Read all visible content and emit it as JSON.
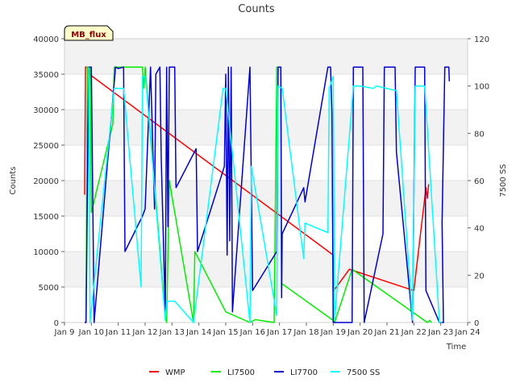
{
  "chart_data": {
    "type": "line",
    "title": "Counts",
    "xlabel": "Time",
    "ylabel": "Counts",
    "y2label": "7500 SS",
    "badge": "MB_flux",
    "ylim": [
      0,
      40000
    ],
    "y2lim": [
      0,
      120
    ],
    "xlim": [
      0,
      15
    ],
    "y_ticks": [
      0,
      5000,
      10000,
      15000,
      20000,
      25000,
      30000,
      35000,
      40000
    ],
    "y2_ticks": [
      0,
      20,
      40,
      60,
      80,
      100,
      120
    ],
    "x_tick_labels": [
      "Jan 9",
      "Jan 10",
      "Jan 11",
      "Jan 12",
      "Jan 13",
      "Jan 14",
      "Jan 15",
      "Jan 16",
      "Jan 17",
      "Jan 18",
      "Jan 19",
      "Jan 20",
      "Jan 21",
      "Jan 22",
      "Jan 23",
      "Jan 24"
    ],
    "grid": true,
    "legend_position": "bottom",
    "series": [
      {
        "name": "WMP",
        "color": "#ff0000",
        "axis": "left",
        "points": [
          [
            0.75,
            18000
          ],
          [
            0.78,
            36000
          ],
          [
            0.9,
            36000
          ],
          [
            0.92,
            35000
          ],
          [
            10.0,
            9500
          ],
          [
            10.02,
            4500
          ],
          [
            10.6,
            7500
          ],
          [
            13.0,
            4500
          ],
          [
            13.45,
            19000
          ],
          [
            13.5,
            17500
          ],
          [
            13.55,
            19500
          ]
        ]
      },
      {
        "name": "LI7500",
        "color": "#00ee00",
        "axis": "left",
        "points": [
          [
            0.8,
            0
          ],
          [
            0.85,
            36000
          ],
          [
            0.95,
            36000
          ],
          [
            1.0,
            15500
          ],
          [
            1.8,
            28000
          ],
          [
            1.85,
            36000
          ],
          [
            2.0,
            36000
          ],
          [
            2.9,
            36000
          ],
          [
            2.95,
            33000
          ],
          [
            3.0,
            36000
          ],
          [
            3.75,
            1000
          ],
          [
            3.8,
            0
          ],
          [
            3.9,
            20000
          ],
          [
            4.8,
            0
          ],
          [
            4.85,
            10000
          ],
          [
            6.0,
            1500
          ],
          [
            6.9,
            0
          ],
          [
            7.1,
            400
          ],
          [
            7.8,
            0
          ],
          [
            7.9,
            36000
          ],
          [
            8.05,
            36000
          ],
          [
            8.08,
            5500
          ],
          [
            10.0,
            300
          ],
          [
            10.05,
            0
          ],
          [
            10.7,
            7500
          ],
          [
            13.5,
            0
          ],
          [
            13.6,
            300
          ],
          [
            13.65,
            0
          ]
        ]
      },
      {
        "name": "LI7700",
        "color": "#0000cc",
        "axis": "left",
        "points": [
          [
            0.75,
            0
          ],
          [
            0.8,
            0
          ],
          [
            0.9,
            36000
          ],
          [
            1.0,
            36000
          ],
          [
            1.1,
            0
          ],
          [
            1.9,
            36000
          ],
          [
            2.0,
            35800
          ],
          [
            2.2,
            36000
          ],
          [
            2.25,
            10000
          ],
          [
            2.9,
            15000
          ],
          [
            3.0,
            16000
          ],
          [
            3.2,
            36000
          ],
          [
            3.35,
            16000
          ],
          [
            3.4,
            35000
          ],
          [
            3.55,
            36000
          ],
          [
            3.6,
            23000
          ],
          [
            3.75,
            1500
          ],
          [
            3.8,
            36000
          ],
          [
            3.85,
            13500
          ],
          [
            3.9,
            36000
          ],
          [
            4.1,
            36000
          ],
          [
            4.15,
            19000
          ],
          [
            4.9,
            24500
          ],
          [
            4.95,
            10000
          ],
          [
            5.95,
            22000
          ],
          [
            6.0,
            35000
          ],
          [
            6.05,
            9500
          ],
          [
            6.1,
            36000
          ],
          [
            6.15,
            11500
          ],
          [
            6.2,
            36000
          ],
          [
            6.25,
            1500
          ],
          [
            6.9,
            36000
          ],
          [
            7.0,
            4500
          ],
          [
            7.9,
            10000
          ],
          [
            7.95,
            36000
          ],
          [
            8.05,
            36000
          ],
          [
            8.08,
            3500
          ],
          [
            8.1,
            12500
          ],
          [
            8.9,
            19000
          ],
          [
            8.95,
            17000
          ],
          [
            9.8,
            36000
          ],
          [
            9.9,
            36000
          ],
          [
            9.95,
            29500
          ],
          [
            10.0,
            0
          ],
          [
            10.7,
            0
          ],
          [
            10.75,
            36000
          ],
          [
            11.1,
            36000
          ],
          [
            11.15,
            0
          ],
          [
            11.85,
            12500
          ],
          [
            11.9,
            36000
          ],
          [
            12.3,
            36000
          ],
          [
            12.35,
            24000
          ],
          [
            12.95,
            0
          ],
          [
            13.05,
            36000
          ],
          [
            13.4,
            36000
          ],
          [
            13.45,
            4500
          ],
          [
            13.95,
            0
          ],
          [
            14.1,
            0
          ],
          [
            14.05,
            14000
          ],
          [
            14.15,
            36000
          ],
          [
            14.3,
            36000
          ],
          [
            14.32,
            34000
          ]
        ]
      },
      {
        "name": "7500 SS",
        "color": "#00ffff",
        "axis": "right",
        "points": [
          [
            0.9,
            108
          ],
          [
            0.95,
            0
          ],
          [
            1.85,
            99
          ],
          [
            2.2,
            99
          ],
          [
            2.85,
            15
          ],
          [
            2.9,
            104
          ],
          [
            3.0,
            104
          ],
          [
            3.05,
            99
          ],
          [
            3.75,
            1
          ],
          [
            3.8,
            9
          ],
          [
            4.1,
            9
          ],
          [
            4.8,
            0
          ],
          [
            5.9,
            99
          ],
          [
            6.0,
            99
          ],
          [
            6.9,
            0
          ],
          [
            6.95,
            66
          ],
          [
            7.9,
            3
          ],
          [
            7.95,
            100
          ],
          [
            8.1,
            99
          ],
          [
            8.9,
            27
          ],
          [
            8.95,
            42
          ],
          [
            9.8,
            38
          ],
          [
            9.85,
            99
          ],
          [
            10.0,
            104
          ],
          [
            10.05,
            1
          ],
          [
            10.75,
            100
          ],
          [
            11.0,
            100
          ],
          [
            11.5,
            99
          ],
          [
            11.6,
            100
          ],
          [
            12.35,
            98
          ],
          [
            12.95,
            1
          ],
          [
            13.05,
            100
          ],
          [
            13.4,
            100
          ],
          [
            13.95,
            0
          ],
          [
            14.05,
            0
          ]
        ]
      }
    ]
  }
}
